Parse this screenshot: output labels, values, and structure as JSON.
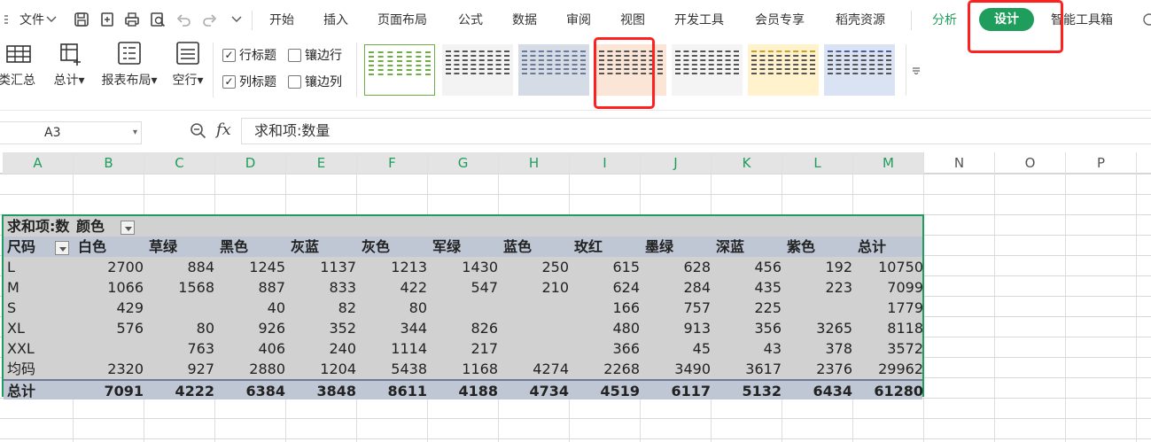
{
  "toolbar": {
    "file_label": "文件",
    "menu_tabs": [
      "开始",
      "插入",
      "页面布局",
      "公式",
      "数据",
      "审阅",
      "视图",
      "开发工具",
      "会员专享",
      "稻壳资源"
    ],
    "analyze_label": "分析",
    "design_label": "设计",
    "smart_tools_label": "智能工具箱",
    "active_color": "#1e9d5c"
  },
  "ribbon": {
    "subtotal_label": "类汇总",
    "grand_total_label": "总计",
    "report_layout_label": "报表布局",
    "blank_row_label": "空行",
    "row_headers_label": "行标题",
    "banded_rows_label": "镶边行",
    "col_headers_label": "列标题",
    "banded_cols_label": "镶边列",
    "row_headers_checked": true,
    "col_headers_checked": true,
    "banded_rows_checked": false,
    "banded_cols_checked": false,
    "style_accent_colors": [
      "#70ad47",
      "#555555",
      "#8497b0",
      "#f4b183",
      "#555555",
      "#ffd966",
      "#8ea9db"
    ]
  },
  "formula_bar": {
    "name_box": "A3",
    "fx_label": "fx",
    "content": "求和项:数量"
  },
  "columns": [
    "A",
    "B",
    "C",
    "D",
    "E",
    "F",
    "G",
    "H",
    "I",
    "J",
    "K",
    "L",
    "M",
    "N",
    "O",
    "P"
  ],
  "pivot": {
    "title_cell": "求和项:数",
    "col_field": "颜色",
    "row_field": "尺码",
    "headers": [
      "白色",
      "草绿",
      "黑色",
      "灰蓝",
      "灰色",
      "军绿",
      "蓝色",
      "玫红",
      "墨绿",
      "深蓝",
      "紫色",
      "总计"
    ],
    "rows": [
      {
        "label": "L",
        "values": [
          "2700",
          "884",
          "1245",
          "1137",
          "1213",
          "1430",
          "250",
          "615",
          "628",
          "456",
          "192",
          "10750"
        ]
      },
      {
        "label": "M",
        "values": [
          "1066",
          "1568",
          "887",
          "833",
          "422",
          "547",
          "210",
          "624",
          "284",
          "435",
          "223",
          "7099"
        ]
      },
      {
        "label": "S",
        "values": [
          "429",
          "",
          "40",
          "82",
          "80",
          "",
          "",
          "166",
          "757",
          "225",
          "",
          "1779"
        ]
      },
      {
        "label": "XL",
        "values": [
          "576",
          "80",
          "926",
          "352",
          "344",
          "826",
          "",
          "480",
          "913",
          "356",
          "3265",
          "8118"
        ]
      },
      {
        "label": "XXL",
        "values": [
          "",
          "763",
          "406",
          "240",
          "1114",
          "217",
          "",
          "366",
          "45",
          "43",
          "378",
          "3572"
        ]
      },
      {
        "label": "均码",
        "values": [
          "2320",
          "927",
          "2880",
          "1204",
          "5438",
          "1168",
          "4274",
          "2268",
          "3490",
          "3617",
          "2376",
          "29962"
        ]
      }
    ],
    "total_label": "总计",
    "totals": [
      "7091",
      "4222",
      "6384",
      "3848",
      "8611",
      "4188",
      "4734",
      "4519",
      "6117",
      "5132",
      "6434",
      "61280"
    ]
  }
}
